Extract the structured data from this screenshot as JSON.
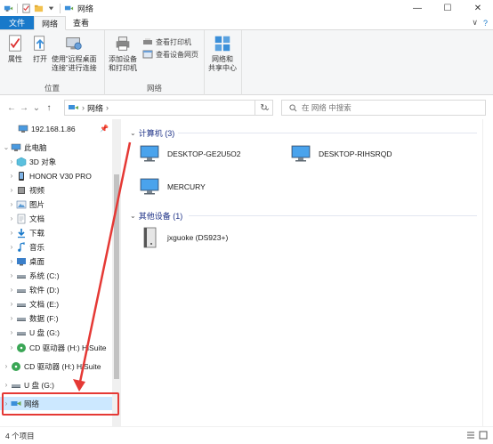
{
  "window": {
    "title": "网络",
    "minimize_glyph": "—",
    "maximize_glyph": "☐",
    "close_glyph": "✕"
  },
  "tabs": [
    {
      "label": "文件"
    },
    {
      "label": "网络"
    },
    {
      "label": "查看"
    }
  ],
  "ribbon": {
    "location_group": {
      "label": "位置",
      "properties": "属性",
      "open": "打开",
      "remote_desktop_line1": "使用“远程桌面",
      "remote_desktop_line2": "连接”进行连接"
    },
    "network_group": {
      "label": "网络",
      "add_device_line1": "添加设备",
      "add_device_line2": "和打印机",
      "view_printers": "查看打印机",
      "view_device_page": "查看设备网页",
      "network_center_line1": "网络和",
      "network_center_line2": "共享中心"
    }
  },
  "address": {
    "path": "网络",
    "separator": "›",
    "refresh_glyph": "↻",
    "search_placeholder": "在 网络 中搜索"
  },
  "sidebar": {
    "items": [
      {
        "label": "192.168.1.86",
        "icon": "computer-icon"
      },
      {
        "label": "此电脑",
        "icon": "pc-icon"
      },
      {
        "label": "3D 对象",
        "icon": "cube-icon"
      },
      {
        "label": "HONOR V30 PRO",
        "icon": "phone-icon"
      },
      {
        "label": "视频",
        "icon": "video-icon"
      },
      {
        "label": "图片",
        "icon": "picture-icon"
      },
      {
        "label": "文档",
        "icon": "document-icon"
      },
      {
        "label": "下载",
        "icon": "download-icon"
      },
      {
        "label": "音乐",
        "icon": "music-icon"
      },
      {
        "label": "桌面",
        "icon": "desktop-icon"
      },
      {
        "label": "系统 (C:)",
        "icon": "drive-icon"
      },
      {
        "label": "软件 (D:)",
        "icon": "drive-icon"
      },
      {
        "label": "文档 (E:)",
        "icon": "drive-icon"
      },
      {
        "label": "数据 (F:)",
        "icon": "drive-icon"
      },
      {
        "label": "U 盘 (G:)",
        "icon": "usb-drive-icon"
      },
      {
        "label": "CD 驱动器 (H:) HiSuite",
        "icon": "cd-icon"
      },
      {
        "label": "CD 驱动器 (H:) HiSuite",
        "icon": "cd-icon"
      },
      {
        "label": "U 盘 (G:)",
        "icon": "usb-drive-icon"
      },
      {
        "label": "网络",
        "icon": "network-icon"
      }
    ]
  },
  "content": {
    "computers_group": {
      "label": "计算机 (3)",
      "items": [
        "DESKTOP-GE2U5O2",
        "DESKTOP-RIHSRQD",
        "MERCURY"
      ]
    },
    "other_group": {
      "label": "其他设备 (1)",
      "items": [
        "jxguoke (DS923+)"
      ]
    }
  },
  "status": {
    "count": "4 个项目"
  },
  "colors": {
    "accent": "#1979ca",
    "selection": "#cce8ff",
    "group_header": "#1e3287",
    "annotation": "#e53935"
  }
}
